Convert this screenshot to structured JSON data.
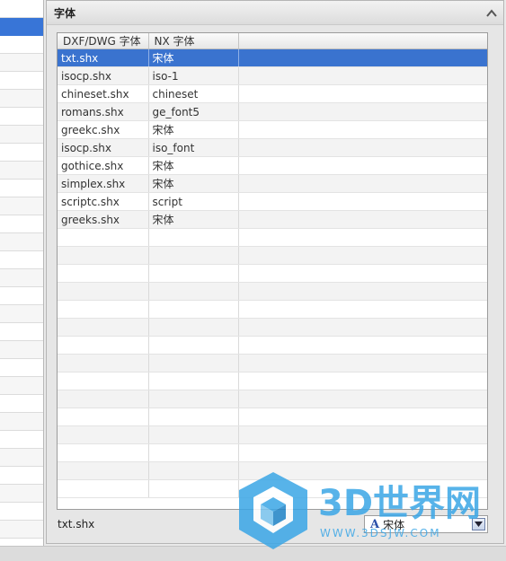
{
  "panel": {
    "title": "字体",
    "collapse_icon": "chevron-up-icon"
  },
  "table": {
    "headers": [
      "DXF/DWG 字体",
      "NX 字体",
      ""
    ],
    "rows": [
      {
        "dxf": "txt.shx",
        "nx": "宋体"
      },
      {
        "dxf": "isocp.shx",
        "nx": "iso-1"
      },
      {
        "dxf": "chineset.shx",
        "nx": "chineset"
      },
      {
        "dxf": "romans.shx",
        "nx": "ge_font5"
      },
      {
        "dxf": "greekc.shx",
        "nx": "宋体"
      },
      {
        "dxf": "isocp.shx",
        "nx": "iso_font"
      },
      {
        "dxf": "gothice.shx",
        "nx": "宋体"
      },
      {
        "dxf": "simplex.shx",
        "nx": "宋体"
      },
      {
        "dxf": "scriptc.shx",
        "nx": "script"
      },
      {
        "dxf": "greeks.shx",
        "nx": "宋体"
      }
    ],
    "selected_index": 0,
    "empty_rows": 15
  },
  "footer": {
    "current_value": "txt.shx",
    "font_select_value": "宋体",
    "font_select_icon": "font-a-icon"
  },
  "watermark": {
    "brand": "3D世界网",
    "url": "WWW.3DSJW.COM"
  },
  "colors": {
    "selection": "#3a73cf",
    "watermark": "#3aa6e6"
  }
}
